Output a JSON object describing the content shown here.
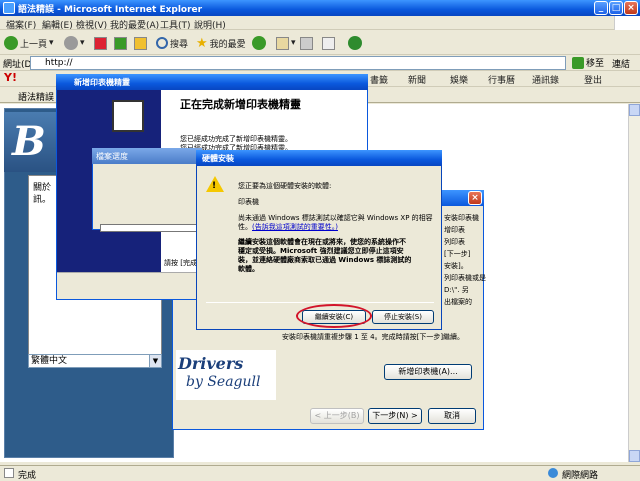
{
  "ie": {
    "title": "語法精誤 - Microsoft Internet Explorer",
    "menu": [
      "檔案(F)",
      "編輯(E)",
      "檢視(V)",
      "我的最愛(A)",
      "工具(T)",
      "說明(H)"
    ],
    "toolbar": {
      "back": "上一頁",
      "search": "搜尋",
      "favorites": "我的最愛"
    },
    "address_label": "網址(D)",
    "address_value": "http://",
    "go": "移至",
    "links": "連結",
    "yahoo": {
      "logo": "Y!",
      "items": [
        "書籤",
        "新聞",
        "娛樂",
        "行事曆",
        "通訊錄",
        "登出"
      ]
    },
    "tab_label": "語法精誤",
    "status": "完成",
    "zone": "網際網路"
  },
  "setup": {
    "banner": "B",
    "text1": "關於",
    "text2": "訊。",
    "lang": "繁體中文"
  },
  "wizard": {
    "title": "新增印表機精靈",
    "heading": "正在完成新增印表機精靈",
    "line1": "您已經成功完成了新增印表機精靈。",
    "line2": "您已經成功完成了新增印表機精靈。",
    "partial": "請按 [完成"
  },
  "filecopy": {
    "title": "檔案選度"
  },
  "seagull": {
    "right_text": [
      "安裝印表機",
      "增印表",
      "列印表",
      "[下一步]",
      "安裝]。",
      "列印表機或是",
      "D:\\\". 另",
      "出檔案的"
    ],
    "instruction": "安裝印表機請重複步驟 1 至 4。完成時請按[下一步]繼續。",
    "add_printer": "新增印表機(A)...",
    "back": "< 上一步(B)",
    "next": "下一步(N) >",
    "cancel": "取消",
    "drivers": "Drivers",
    "by_seagull": "by Seagull"
  },
  "hw": {
    "title": "硬體安裝",
    "msg": "您正要為這個硬體安裝的軟體:",
    "device": "印表機",
    "warn1": "尚未通過 Windows 標誌測試以確認它與 Windows XP 的相容",
    "warn2": "性。",
    "link": "(告訴我這項測試的重要性。)",
    "bold1": "繼續安裝這個軟體會在現在或將來，使您的系統操作不",
    "bold2": "穩定或受損。Microsoft 強烈建議您立即停止這項安",
    "bold3": "裝，並連絡硬體廠商索取已通過 Windows 標誌測試的",
    "bold4": "軟體。",
    "continue": "繼續安裝(C)",
    "stop": "停止安裝(S)"
  }
}
